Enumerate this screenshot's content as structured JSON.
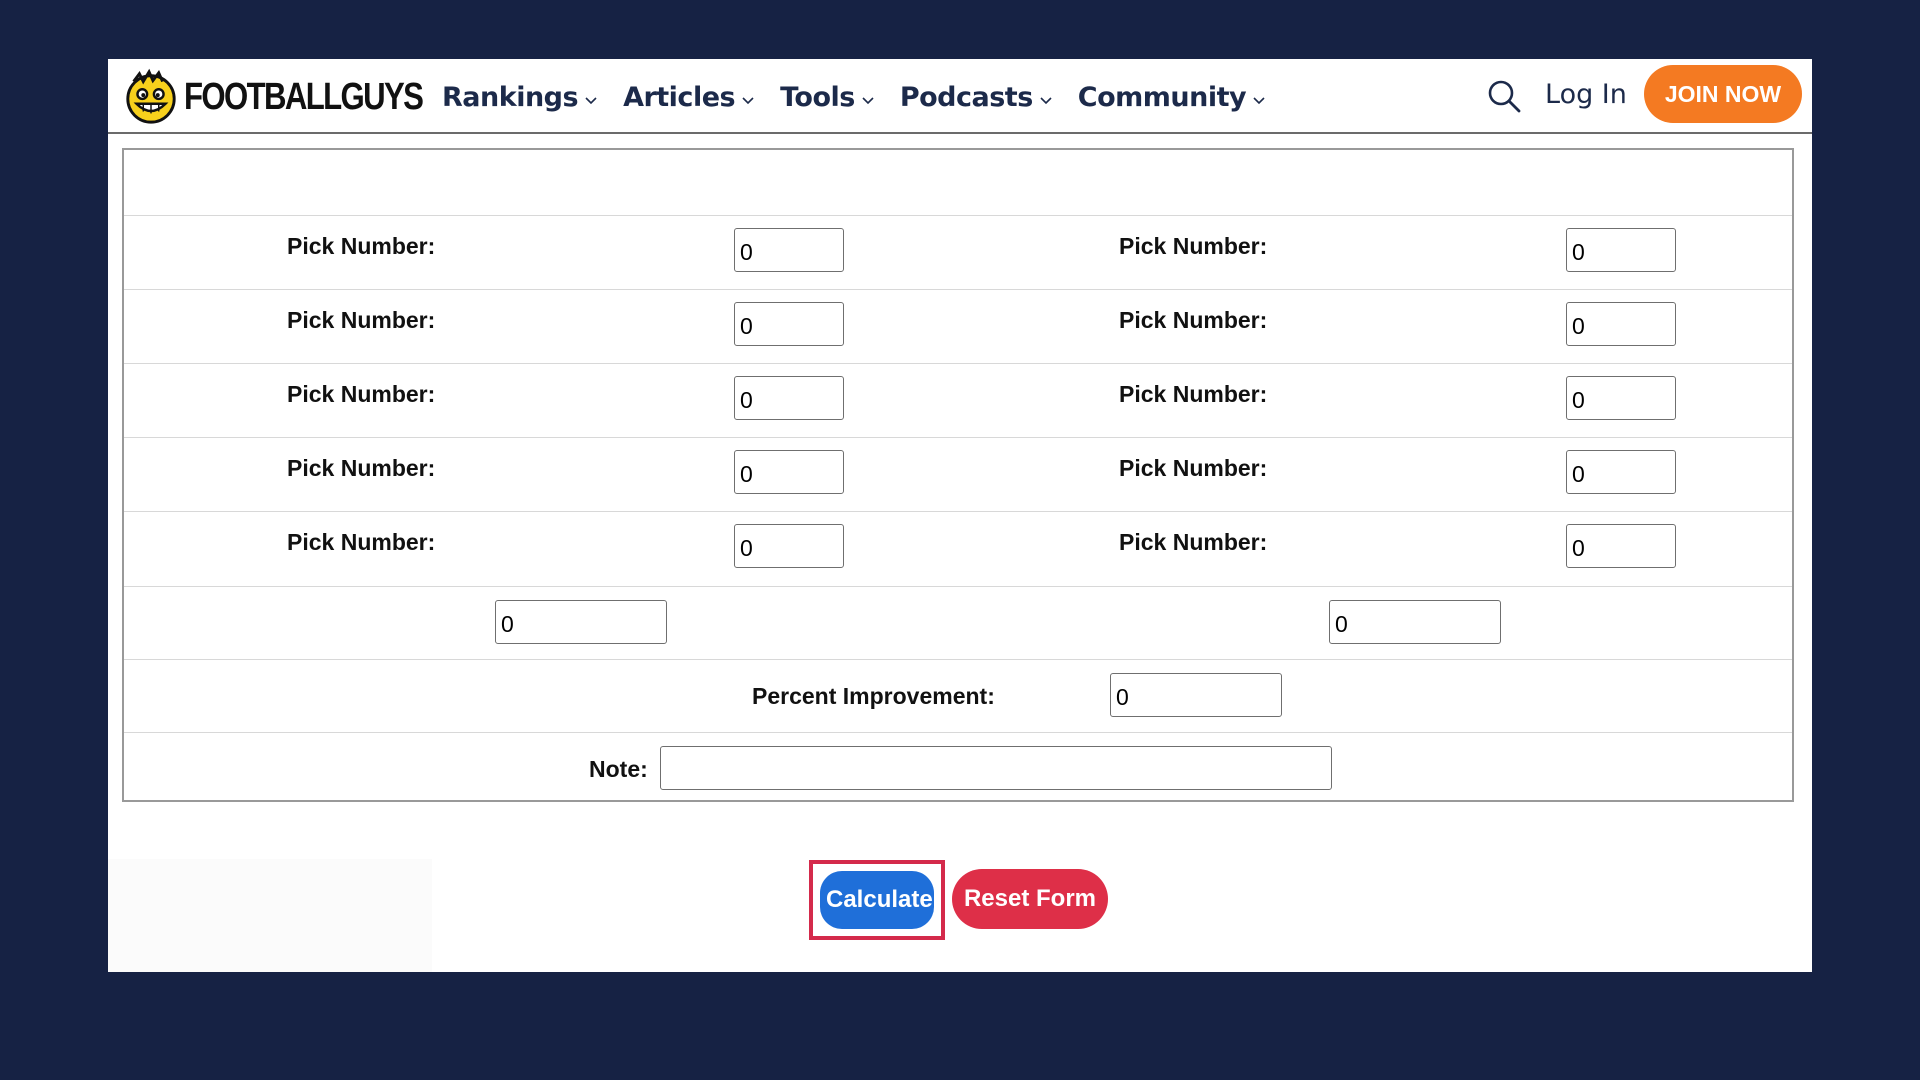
{
  "header": {
    "logo_text": "FOOTBALLGUYS",
    "nav": [
      {
        "label": "Rankings"
      },
      {
        "label": "Articles"
      },
      {
        "label": "Tools"
      },
      {
        "label": "Podcasts"
      },
      {
        "label": "Community"
      }
    ],
    "login_label": "Log In",
    "join_label": "JOIN NOW"
  },
  "form": {
    "pick_rows": [
      {
        "left_label": "Pick Number:",
        "left_value": "0",
        "right_label": "Pick Number:",
        "right_value": "0"
      },
      {
        "left_label": "Pick Number:",
        "left_value": "0",
        "right_label": "Pick Number:",
        "right_value": "0"
      },
      {
        "left_label": "Pick Number:",
        "left_value": "0",
        "right_label": "Pick Number:",
        "right_value": "0"
      },
      {
        "left_label": "Pick Number:",
        "left_value": "0",
        "right_label": "Pick Number:",
        "right_value": "0"
      },
      {
        "left_label": "Pick Number:",
        "left_value": "0",
        "right_label": "Pick Number:",
        "right_value": "0"
      }
    ],
    "totals": {
      "left_value": "0",
      "right_value": "0"
    },
    "percent_label": "Percent Improvement:",
    "percent_value": "0",
    "note_label": "Note:",
    "note_value": ""
  },
  "buttons": {
    "calculate_label": "Calculate",
    "reset_label": "Reset Form"
  },
  "colors": {
    "background": "#162244",
    "join": "#f47a22",
    "calculate": "#1f6fd9",
    "reset": "#de2f48",
    "highlight": "#d42a4b"
  }
}
